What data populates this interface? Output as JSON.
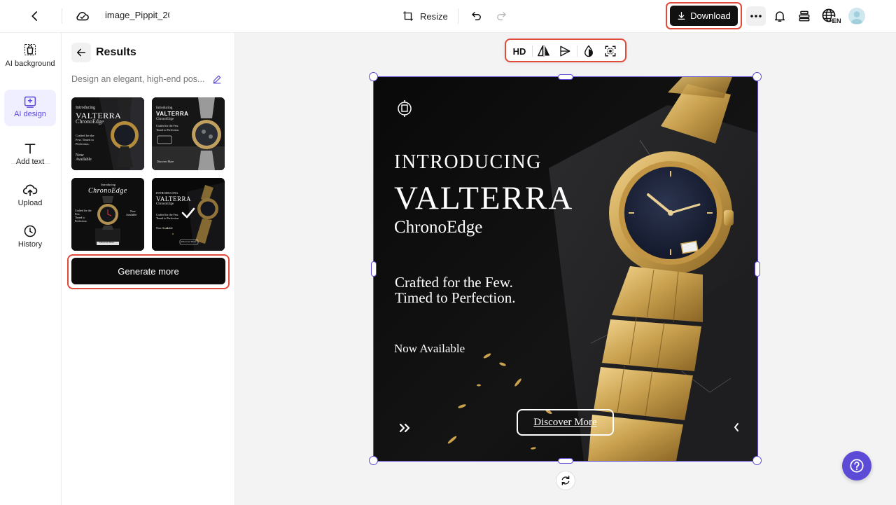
{
  "topbar": {
    "filename": "image_Pippit_20",
    "resize_label": "Resize",
    "download_label": "Download",
    "language_code": "EN"
  },
  "rail": {
    "items": [
      {
        "id": "ai-background",
        "label": "AI background",
        "icon": "shopping-bag-icon"
      },
      {
        "id": "ai-design",
        "label": "AI design",
        "icon": "ai-design-icon",
        "active": true
      },
      {
        "id": "add-text",
        "label": "Add text",
        "icon": "text-icon"
      },
      {
        "id": "upload",
        "label": "Upload",
        "icon": "cloud-upload-icon"
      },
      {
        "id": "history",
        "label": "History",
        "icon": "clock-icon"
      }
    ]
  },
  "panel": {
    "title": "Results",
    "prompt": "Design an elegant, high-end pos...",
    "generate_label": "Generate more",
    "thumbnails": [
      {
        "small": "Introducing",
        "big": "VALTERRA",
        "mid": "ChronoEdge",
        "line1": "Crafted for the",
        "line2": "Few. Timed to",
        "line3": "Perfection.",
        "line4": "Now",
        "line5": "Available"
      },
      {
        "small": "Introducing",
        "big": "VALTERRA",
        "mid": "ChronoEdge",
        "line1": "Crafted for the Few.",
        "line2": "Timed to Perfection.",
        "line3": "Discover More"
      },
      {
        "small": "Introducing",
        "big": "ChronoEdge",
        "line1": "Crafted for the",
        "line2": "Few.",
        "line3": "Timed to",
        "line4": "Perfection.",
        "line5": "Now",
        "line6": "Available",
        "line7": "Discover More"
      },
      {
        "small": "INTRODUCING",
        "big": "VALTERRA",
        "mid": "ChronoEdge",
        "line1": "Crafted for the Few.",
        "line2": "Timed to Perfection.",
        "line3": "Now Available",
        "line4": "Discover More",
        "selected": true
      }
    ]
  },
  "canvas": {
    "toolbar": {
      "hd_label": "HD"
    },
    "poster": {
      "intro": "INTRODUCING",
      "brand": "VALTERRA",
      "subbrand": "ChronoEdge",
      "tagline1": "Crafted for the Few.",
      "tagline2": "Timed to Perfection.",
      "availability": "Now Available",
      "cta": "Discover More"
    }
  },
  "colors": {
    "accent": "#5b4bd6",
    "highlight": "#e04a3a",
    "gold": "#c9a14f"
  }
}
